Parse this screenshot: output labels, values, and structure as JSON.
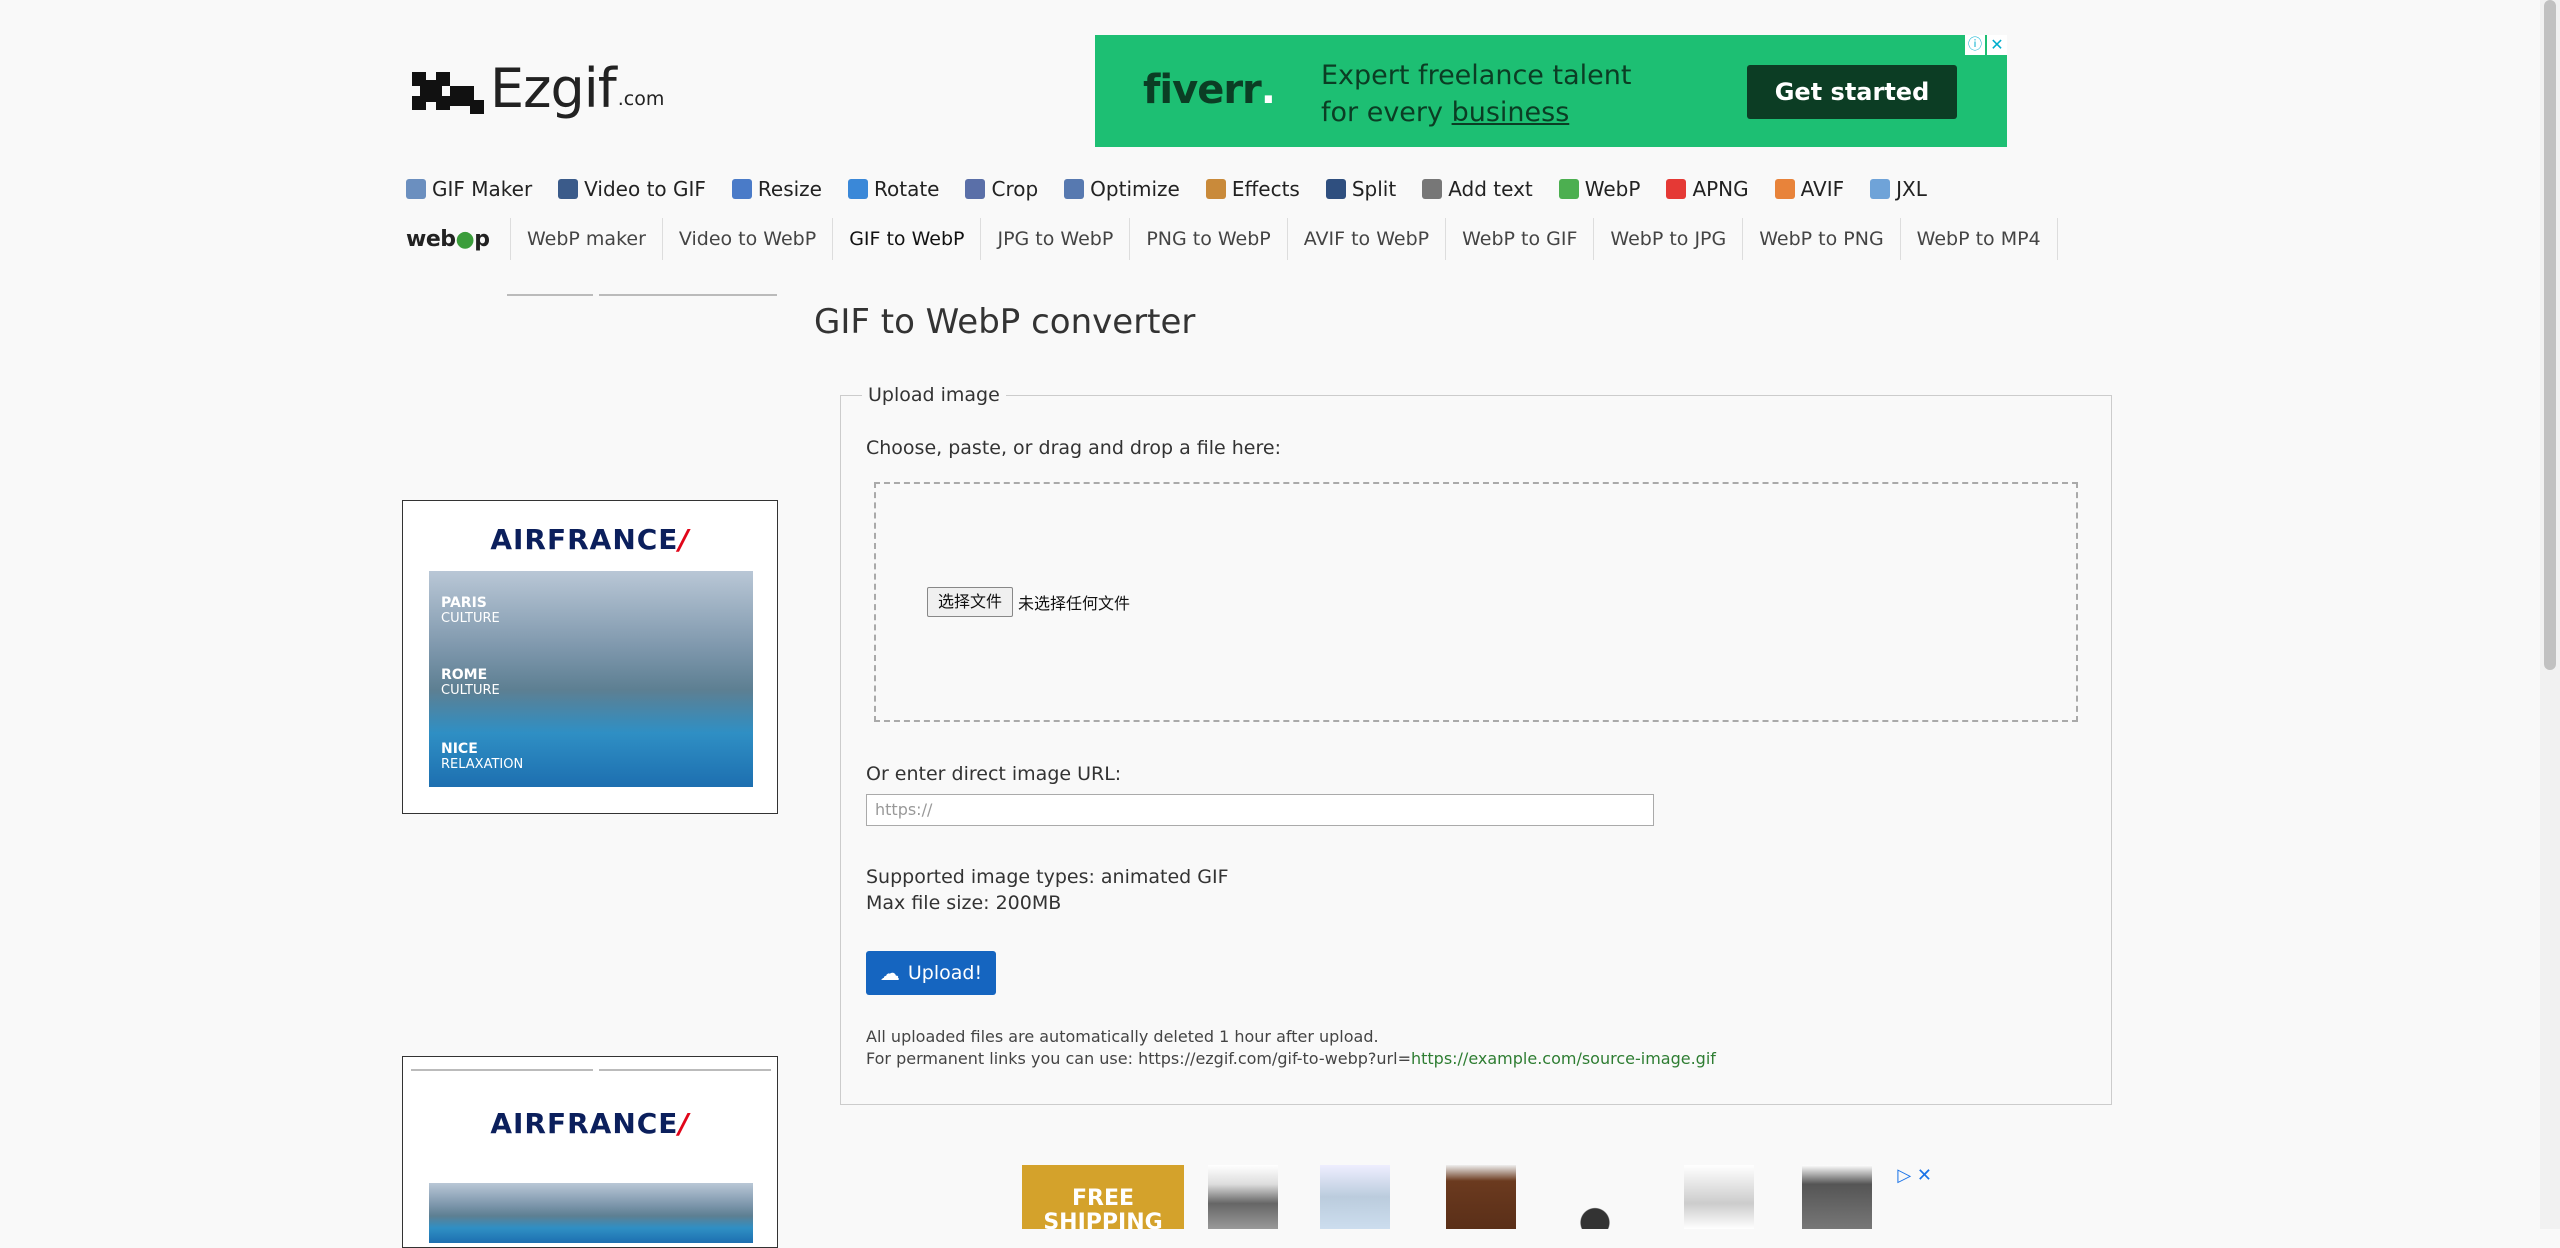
{
  "logo": {
    "word": "Ezgif",
    "suffix": ".com"
  },
  "top_ad": {
    "brand": "fiverr",
    "brand_dot": ".",
    "line1": "Expert freelance talent",
    "line2_prefix": "for every ",
    "line2_link": "business",
    "cta": "Get started",
    "info": "ⓘ",
    "close": "✕"
  },
  "main_nav": [
    {
      "label": "GIF Maker",
      "icon": "gif-maker-icon",
      "color": "#6b8fbf"
    },
    {
      "label": "Video to GIF",
      "icon": "film-icon",
      "color": "#3b5b8a"
    },
    {
      "label": "Resize",
      "icon": "resize-icon",
      "color": "#4a7bc8"
    },
    {
      "label": "Rotate",
      "icon": "rotate-icon",
      "color": "#3a88d8"
    },
    {
      "label": "Crop",
      "icon": "crop-icon",
      "color": "#5a6fa8"
    },
    {
      "label": "Optimize",
      "icon": "optimize-icon",
      "color": "#5779b0"
    },
    {
      "label": "Effects",
      "icon": "palette-icon",
      "color": "#c98a3a"
    },
    {
      "label": "Split",
      "icon": "split-icon",
      "color": "#2f4f7f"
    },
    {
      "label": "Add text",
      "icon": "add-text-icon",
      "color": "#777777"
    },
    {
      "label": "WebP",
      "icon": "webp-icon",
      "color": "#4caf50"
    },
    {
      "label": "APNG",
      "icon": "apng-icon",
      "color": "#e53935"
    },
    {
      "label": "AVIF",
      "icon": "avif-icon",
      "color": "#e8833a"
    },
    {
      "label": "JXL",
      "icon": "jxl-icon",
      "color": "#6fa3d8"
    }
  ],
  "sub_nav": {
    "logo": "webp",
    "items": [
      "WebP maker",
      "Video to WebP",
      "GIF to WebP",
      "JPG to WebP",
      "PNG to WebP",
      "AVIF to WebP",
      "WebP to GIF",
      "WebP to JPG",
      "WebP to PNG",
      "WebP to MP4"
    ],
    "active_index": 2
  },
  "side_ad_1": {
    "brand": "AIRFRANCE",
    "slash": "/",
    "bands": [
      {
        "city": "PARIS",
        "tag": "CULTURE"
      },
      {
        "city": "ROME",
        "tag": "CULTURE"
      },
      {
        "city": "NICE",
        "tag": "RELAXATION"
      }
    ]
  },
  "side_ad_2": {
    "brand": "AIRFRANCE",
    "slash": "/"
  },
  "page_title": "GIF to WebP converter",
  "upload": {
    "legend": "Upload image",
    "choose_label": "Choose, paste, or drag and drop a file here:",
    "file_button": "选择文件",
    "file_status": "未选择任何文件",
    "url_label": "Or enter direct image URL:",
    "url_placeholder": "https://",
    "types": "Supported image types: animated GIF",
    "max_size": "Max file size: 200MB",
    "upload_button": "Upload!",
    "note1": "All uploaded files are automatically deleted 1 hour after upload.",
    "note2_prefix": "For permanent links you can use: https://ezgif.com/gif-to-webp?url=",
    "note2_link": "https://example.com/source-image.gif"
  },
  "bottom_ad": {
    "free_text": "FREE SHIPPING"
  }
}
